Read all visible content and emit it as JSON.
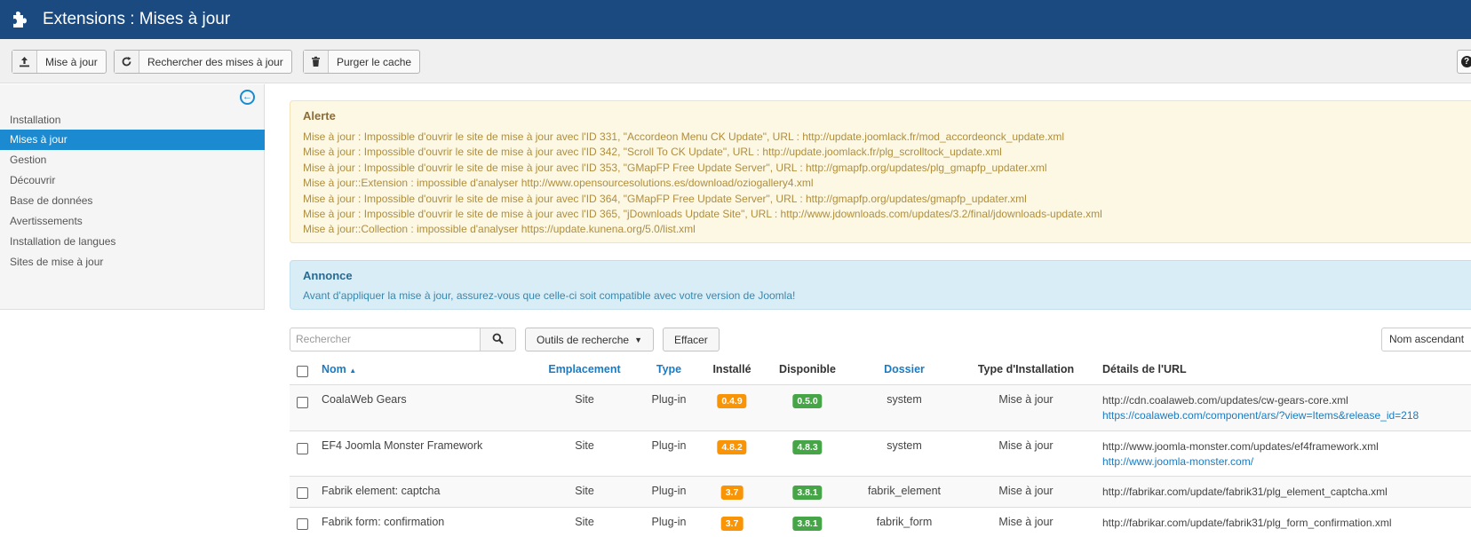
{
  "header": {
    "title": "Extensions : Mises à jour",
    "icon": "puzzle-icon"
  },
  "toolbar": {
    "update": {
      "label": "Mise à jour",
      "icon": "upload-icon"
    },
    "find": {
      "label": "Rechercher des mises à jour",
      "icon": "refresh-icon"
    },
    "purge": {
      "label": "Purger le cache",
      "icon": "trash-icon"
    },
    "help_icon": "question-icon"
  },
  "sidebar": {
    "items": [
      {
        "label": "Installation",
        "active": false
      },
      {
        "label": "Mises à jour",
        "active": true
      },
      {
        "label": "Gestion",
        "active": false
      },
      {
        "label": "Découvrir",
        "active": false
      },
      {
        "label": "Base de données",
        "active": false
      },
      {
        "label": "Avertissements",
        "active": false
      },
      {
        "label": "Installation de langues",
        "active": false
      },
      {
        "label": "Sites de mise à jour",
        "active": false
      }
    ]
  },
  "alert": {
    "title": "Alerte",
    "messages": [
      "Mise à jour : Impossible d'ouvrir le site de mise à jour avec l'ID 331, \"Accordeon Menu CK Update\", URL : http://update.joomlack.fr/mod_accordeonck_update.xml",
      "Mise à jour : Impossible d'ouvrir le site de mise à jour avec l'ID 342, \"Scroll To CK Update\", URL : http://update.joomlack.fr/plg_scrolltock_update.xml",
      "Mise à jour : Impossible d'ouvrir le site de mise à jour avec l'ID 353, \"GMapFP Free Update Server\", URL : http://gmapfp.org/updates/plg_gmapfp_updater.xml",
      "Mise à jour::Extension : impossible d'analyser http://www.opensourcesolutions.es/download/oziogallery4.xml",
      "Mise à jour : Impossible d'ouvrir le site de mise à jour avec l'ID 364, \"GMapFP Free Update Server\", URL : http://gmapfp.org/updates/gmapfp_updater.xml",
      "Mise à jour : Impossible d'ouvrir le site de mise à jour avec l'ID 365, \"jDownloads Update Site\", URL : http://www.jdownloads.com/updates/3.2/final/jdownloads-update.xml",
      "Mise à jour::Collection : impossible d'analyser https://update.kunena.org/5.0/list.xml"
    ]
  },
  "notice": {
    "title": "Annonce",
    "message": "Avant d'appliquer la mise à jour, assurez-vous que celle-ci soit compatible avec votre version de Joomla!"
  },
  "filters": {
    "search_placeholder": "Rechercher",
    "search_tools": "Outils de recherche",
    "clear": "Effacer",
    "sort": "Nom ascendant"
  },
  "table": {
    "headers": {
      "name": "Nom",
      "location": "Emplacement",
      "type": "Type",
      "installed": "Installé",
      "available": "Disponible",
      "folder": "Dossier",
      "install_type": "Type d'Installation",
      "url_details": "Détails de l'URL"
    },
    "rows": [
      {
        "name": "CoalaWeb Gears",
        "location": "Site",
        "type": "Plug-in",
        "installed": "0.4.9",
        "available": "0.5.0",
        "folder": "system",
        "install_type": "Mise à jour",
        "url": "http://cdn.coalaweb.com/updates/cw-gears-core.xml",
        "link": "https://coalaweb.com/component/ars/?view=Items&release_id=218"
      },
      {
        "name": "EF4 Joomla Monster Framework",
        "location": "Site",
        "type": "Plug-in",
        "installed": "4.8.2",
        "available": "4.8.3",
        "folder": "system",
        "install_type": "Mise à jour",
        "url": "http://www.joomla-monster.com/updates/ef4framework.xml",
        "link": "http://www.joomla-monster.com/"
      },
      {
        "name": "Fabrik element: captcha",
        "location": "Site",
        "type": "Plug-in",
        "installed": "3.7",
        "available": "3.8.1",
        "folder": "fabrik_element",
        "install_type": "Mise à jour",
        "url": "http://fabrikar.com/update/fabrik31/plg_element_captcha.xml",
        "link": ""
      },
      {
        "name": "Fabrik form: confirmation",
        "location": "Site",
        "type": "Plug-in",
        "installed": "3.7",
        "available": "3.8.1",
        "folder": "fabrik_form",
        "install_type": "Mise à jour",
        "url": "http://fabrikar.com/update/fabrik31/plg_form_confirmation.xml",
        "link": ""
      }
    ]
  },
  "colors": {
    "header_bg": "#1a4a80",
    "active_sidebar": "#1b8ad0",
    "badge_installed": "#f89406",
    "badge_available": "#46a546",
    "link": "#1b7bc1"
  }
}
